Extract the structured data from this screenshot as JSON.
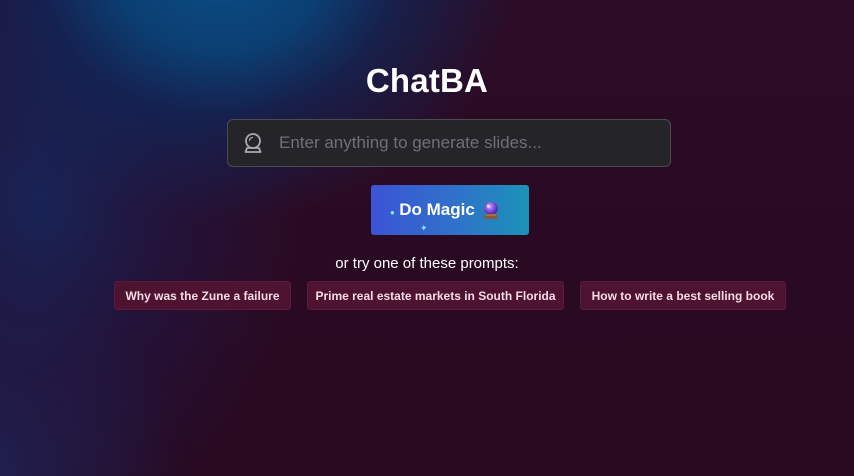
{
  "app": {
    "title": "ChatBA"
  },
  "search": {
    "placeholder": "Enter anything to generate slides...",
    "value": ""
  },
  "action": {
    "label": "Do Magic",
    "icon": "crystal-ball-icon"
  },
  "prompts": {
    "hint": "or try one of these prompts:",
    "items": [
      "Why was the Zune a failure",
      "Prime real estate markets in South Florida",
      "How to write a best selling book"
    ]
  },
  "colors": {
    "background": "#2a0a22",
    "button_start": "#3c53d6",
    "button_end": "#1a93b8",
    "chip": "#4e1331"
  }
}
